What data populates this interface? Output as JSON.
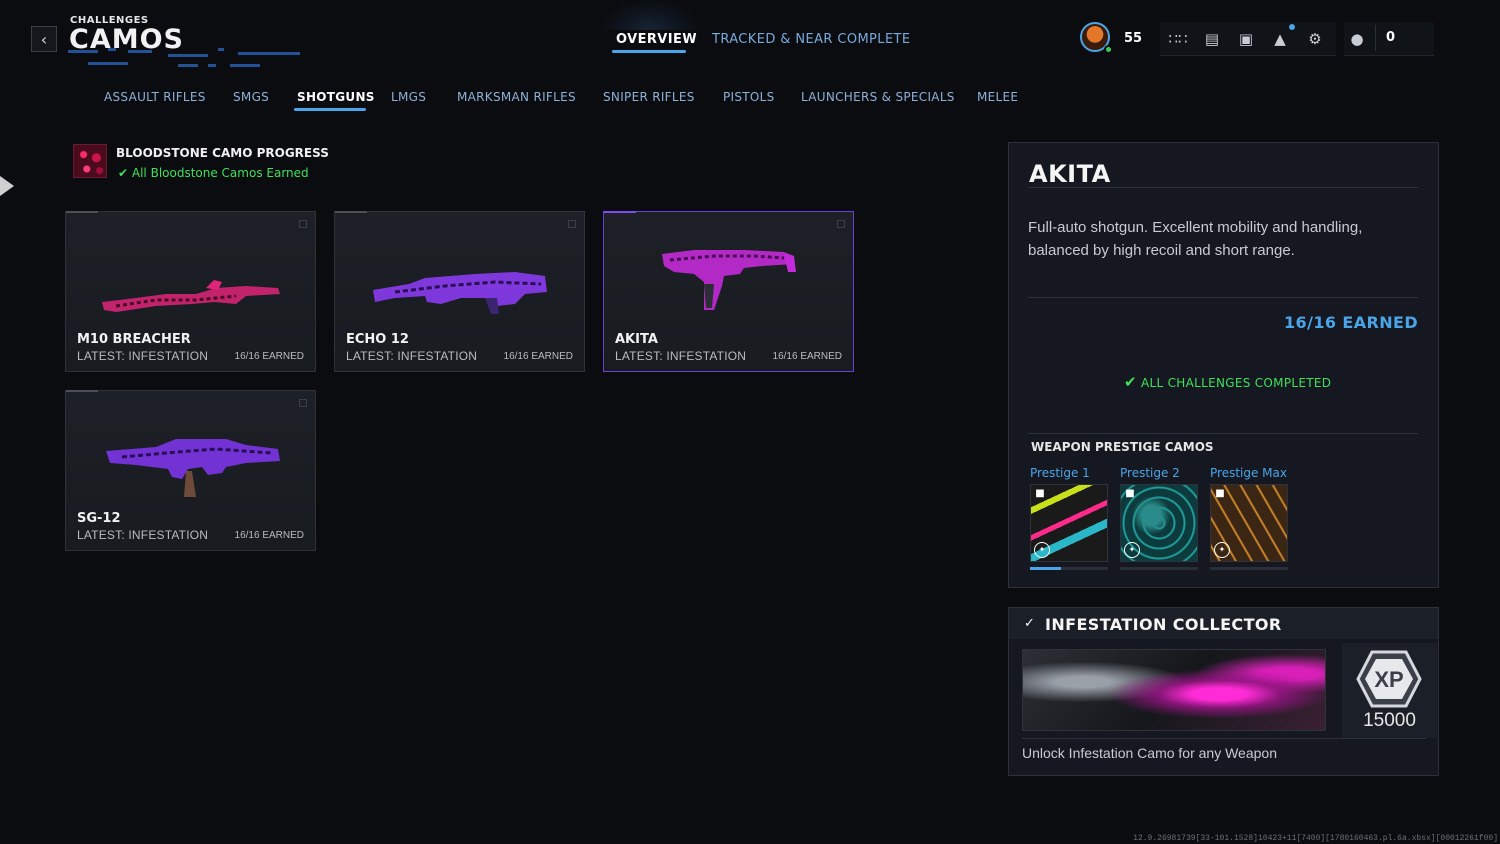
{
  "header": {
    "supertitle": "CHALLENGES",
    "title": "CAMOS",
    "back_icon": "chevron-left-icon",
    "tabs": [
      {
        "label": "OVERVIEW",
        "active": true
      },
      {
        "label": "TRACKED & NEAR COMPLETE",
        "active": false
      }
    ],
    "player_level": "55",
    "currency": "0",
    "icons": [
      "apps-grid-icon",
      "unlock-icon",
      "store-icon",
      "bell-icon",
      "gear-icon",
      "social-icon"
    ]
  },
  "categories": [
    {
      "label": "ASSAULT RIFLES",
      "active": false
    },
    {
      "label": "SMGS",
      "active": false
    },
    {
      "label": "SHOTGUNS",
      "active": true
    },
    {
      "label": "LMGS",
      "active": false
    },
    {
      "label": "MARKSMAN RIFLES",
      "active": false
    },
    {
      "label": "SNIPER RIFLES",
      "active": false
    },
    {
      "label": "PISTOLS",
      "active": false
    },
    {
      "label": "LAUNCHERS & SPECIALS",
      "active": false
    },
    {
      "label": "MELEE",
      "active": false
    }
  ],
  "progress": {
    "title": "BLOODSTONE CAMO PROGRESS",
    "status": "All Bloodstone Camos Earned"
  },
  "weapons": [
    {
      "name": "M10 BREACHER",
      "latest": "LATEST: INFESTATION",
      "earned": "16/16 EARNED",
      "selected": false,
      "camo": "#e0247a"
    },
    {
      "name": "ECHO 12",
      "latest": "LATEST: INFESTATION",
      "earned": "16/16 EARNED",
      "selected": false,
      "camo": "#8a3bf0"
    },
    {
      "name": "AKITA",
      "latest": "LATEST: INFESTATION",
      "earned": "16/16 EARNED",
      "selected": true,
      "camo": "#c32ad8"
    },
    {
      "name": "SG-12",
      "latest": "LATEST: INFESTATION",
      "earned": "16/16 EARNED",
      "selected": false,
      "camo": "#7d35e8"
    }
  ],
  "detail": {
    "title": "AKITA",
    "description": "Full-auto shotgun. Excellent mobility and handling, balanced by high recoil and short range.",
    "earned": "16/16 EARNED",
    "status": "ALL CHALLENGES COMPLETED",
    "prestige_heading": "WEAPON PRESTIGE CAMOS",
    "prestige": [
      {
        "label": "Prestige 1",
        "progress": 0.4
      },
      {
        "label": "Prestige 2",
        "progress": 0
      },
      {
        "label": "Prestige Max",
        "progress": 0
      }
    ]
  },
  "reward": {
    "title": "INFESTATION COLLECTOR",
    "xp_label": "XP",
    "xp": "15000",
    "description": "Unlock Infestation Camo for any Weapon"
  },
  "footer": {
    "build": "12.9.26981739[33-101.1528]10423+11[7400][1780160463.pl.6a.xbsx][00012261f00]"
  }
}
